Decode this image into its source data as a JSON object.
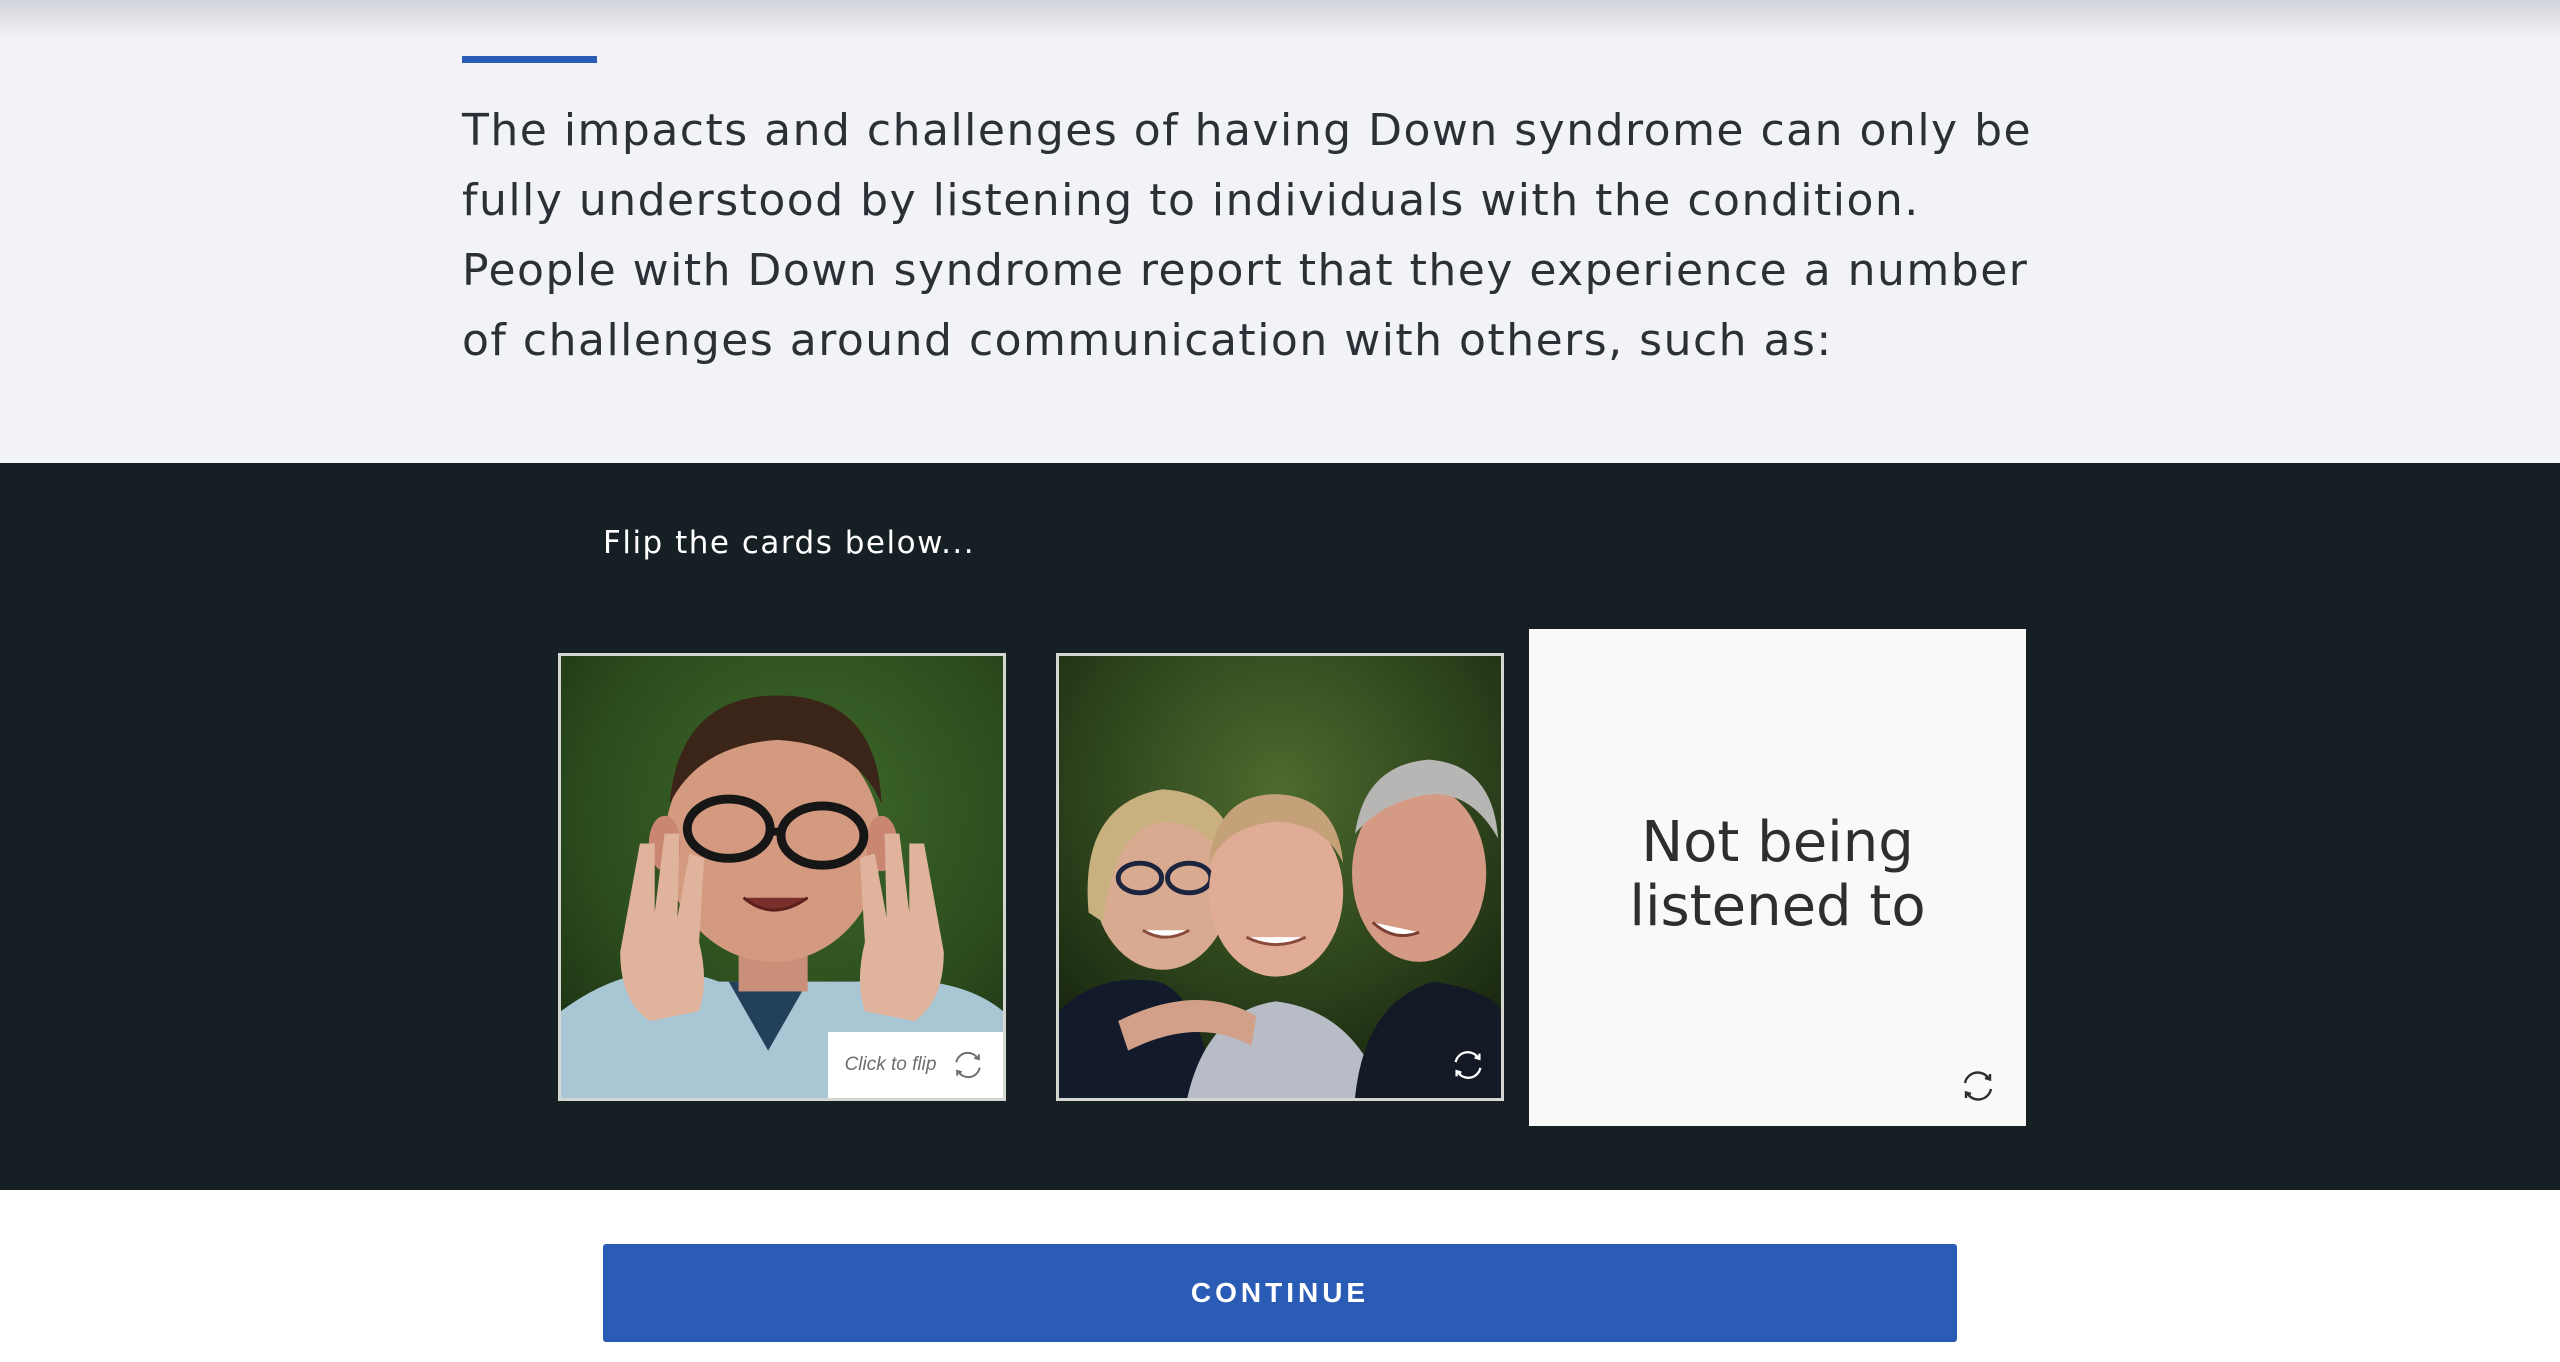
{
  "intro": {
    "text": "The impacts and challenges of having Down syndrome can only be fully understood by listening to individuals with the condition. People with Down syndrome report that they experience a number of challenges around communication with others, such as:"
  },
  "cards": {
    "instruction": "Flip the cards below...",
    "items": [
      {
        "image": "photo-boy-glasses-framing-hands",
        "flip_hint": "Click to flip",
        "icon": "flip-icon"
      },
      {
        "image": "photo-family-smiling-outdoors",
        "icon": "flip-icon"
      },
      {
        "back_text": "Not being listened to",
        "icon": "flip-icon"
      }
    ]
  },
  "footer": {
    "continue_label": "CONTINUE"
  },
  "colors": {
    "accent": "#2b5cb5",
    "intro_bg": "#f2f3f7",
    "cards_bg": "#151f24",
    "card_back_bg": "#f9f9f9"
  }
}
